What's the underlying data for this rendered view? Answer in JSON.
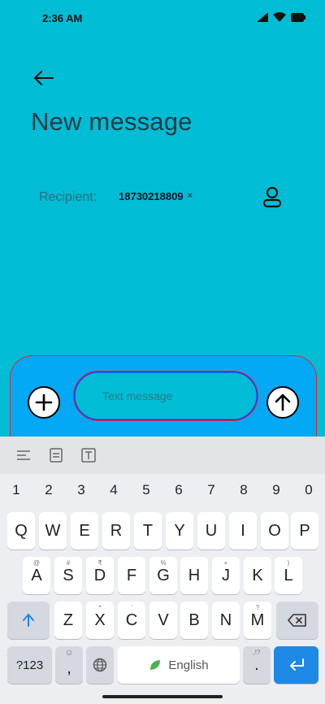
{
  "status": {
    "time": "2:36 AM"
  },
  "header": {
    "title": "New message"
  },
  "recipient": {
    "label": "Recipient:",
    "chip": "18730218809",
    "chip_remove": "×"
  },
  "compose": {
    "placeholder": "Text message"
  },
  "keyboard": {
    "numbers": [
      "1",
      "2",
      "3",
      "4",
      "5",
      "6",
      "7",
      "8",
      "9",
      "0"
    ],
    "row1": [
      "Q",
      "W",
      "E",
      "R",
      "T",
      "Y",
      "U",
      "I",
      "O",
      "P"
    ],
    "row2": [
      "A",
      "S",
      "D",
      "F",
      "G",
      "H",
      "J",
      "K",
      "L"
    ],
    "row2_hints": [
      "@",
      "#",
      "₹",
      "",
      "%",
      "",
      "+",
      "",
      ")"
    ],
    "row3": [
      "Z",
      "X",
      "C",
      "V",
      "B",
      "N",
      "M"
    ],
    "row3_hints": [
      "",
      "*",
      "'",
      "",
      "",
      "",
      "?"
    ],
    "symbols_label": "?123",
    "comma": ",",
    "space_label": "English",
    "period": ".",
    "period_hint": ",!?"
  },
  "colors": {
    "background": "#00BCD4",
    "panel": "#03A9F4",
    "accent_red": "#E8232C",
    "accent_blue": "#2233FF",
    "enter": "#1E88E5"
  }
}
